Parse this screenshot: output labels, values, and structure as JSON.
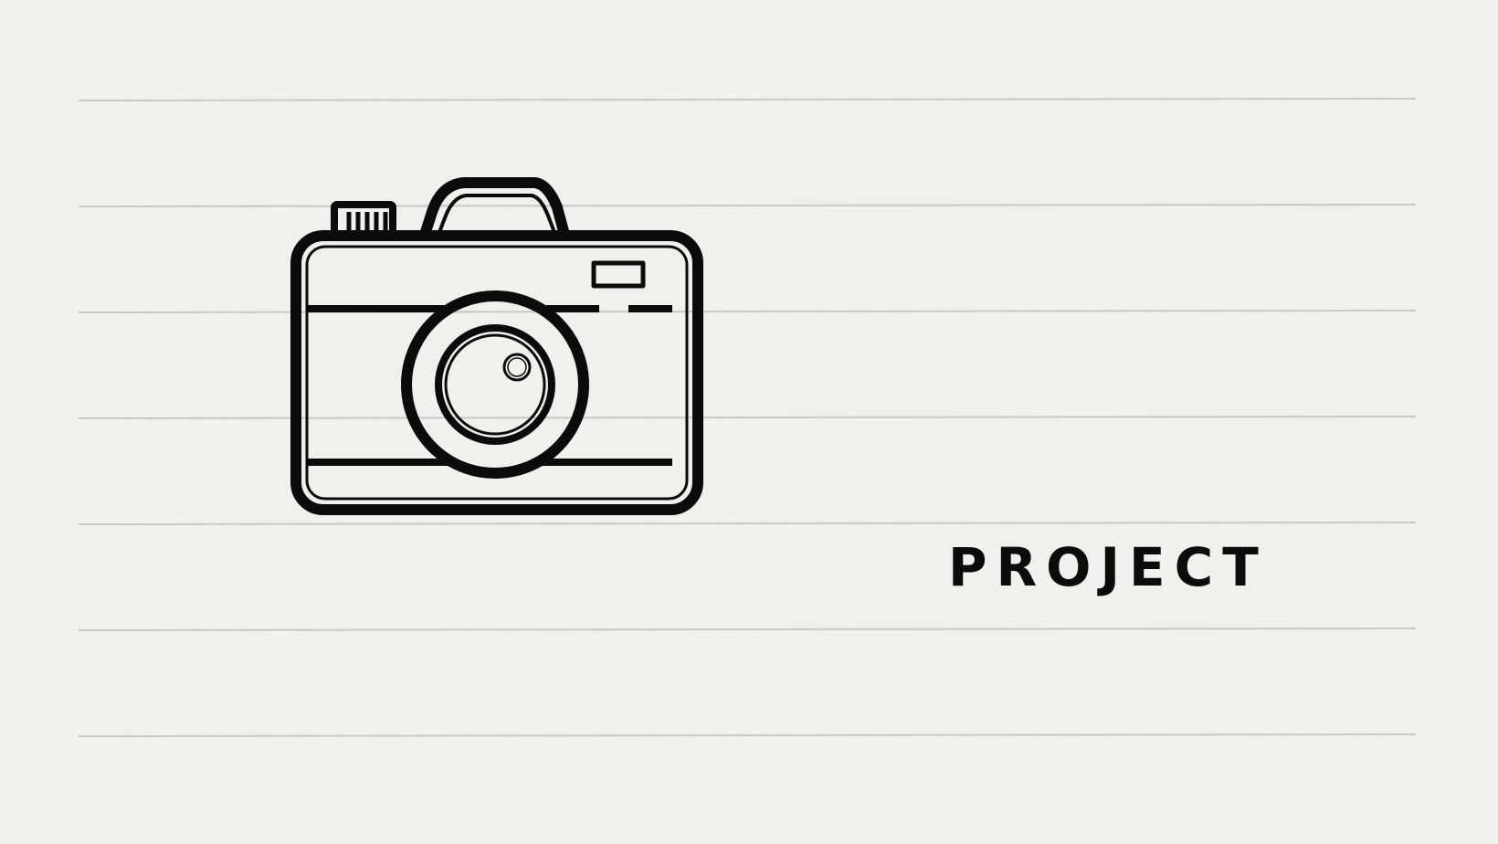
{
  "slide": {
    "title": "PROJECT",
    "icon": "camera-icon",
    "paper_color": "#f1f0ec",
    "rule_color": "#c9c8c4",
    "ink_color": "#0b0b0b"
  }
}
